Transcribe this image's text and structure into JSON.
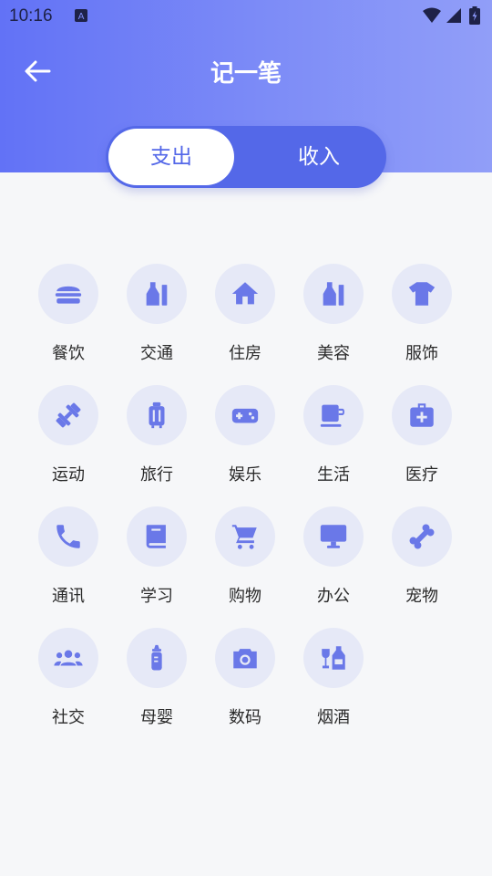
{
  "status_bar": {
    "time": "10:16",
    "notification_icon": "a-icon"
  },
  "header": {
    "title": "记一笔",
    "back_icon": "arrow-left-icon"
  },
  "tabs": [
    {
      "label": "支出",
      "selected": true
    },
    {
      "label": "收入",
      "selected": false
    }
  ],
  "colors": {
    "accent": "#5468e8",
    "header_gradient_start": "#6272f6",
    "header_gradient_end": "#919ef8",
    "icon_bg": "#e6e9f7",
    "icon_fg": "#6a78e8",
    "background": "#f6f7f9"
  },
  "categories": [
    {
      "label": "餐饮",
      "icon": "burger-icon"
    },
    {
      "label": "交通",
      "icon": "bottle-ruler-icon"
    },
    {
      "label": "住房",
      "icon": "house-icon"
    },
    {
      "label": "美容",
      "icon": "bottle-ruler-icon"
    },
    {
      "label": "服饰",
      "icon": "tshirt-icon"
    },
    {
      "label": "运动",
      "icon": "dumbbell-icon"
    },
    {
      "label": "旅行",
      "icon": "luggage-icon"
    },
    {
      "label": "娱乐",
      "icon": "gamepad-icon"
    },
    {
      "label": "生活",
      "icon": "mug-icon"
    },
    {
      "label": "医疗",
      "icon": "medkit-icon"
    },
    {
      "label": "通讯",
      "icon": "phone-icon"
    },
    {
      "label": "学习",
      "icon": "book-icon"
    },
    {
      "label": "购物",
      "icon": "cart-icon"
    },
    {
      "label": "办公",
      "icon": "monitor-icon"
    },
    {
      "label": "宠物",
      "icon": "bone-icon"
    },
    {
      "label": "社交",
      "icon": "people-icon"
    },
    {
      "label": "母婴",
      "icon": "baby-bottle-icon"
    },
    {
      "label": "数码",
      "icon": "camera-icon"
    },
    {
      "label": "烟酒",
      "icon": "wine-bottle-icon"
    }
  ]
}
